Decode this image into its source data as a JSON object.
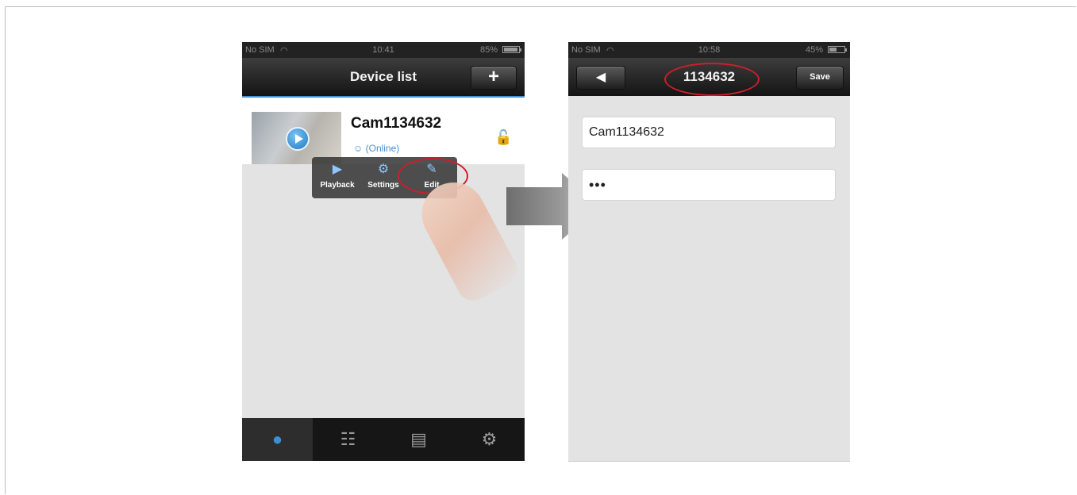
{
  "left_screen": {
    "status": {
      "carrier": "No SIM",
      "time": "10:41",
      "battery": "85%",
      "battery_level": 0.85
    },
    "nav": {
      "title": "Device list",
      "add_label": "+"
    },
    "device": {
      "name": "Cam1134632",
      "status": "(Online)"
    },
    "popup": {
      "items": [
        {
          "label": "Playback",
          "icon": "play-circle-icon"
        },
        {
          "label": "Settings",
          "icon": "gear-icon"
        },
        {
          "label": "Edit",
          "icon": "edit-icon"
        }
      ]
    },
    "tabbar": {
      "icons": [
        "user-icon",
        "grid-icon",
        "toolbox-icon",
        "gear-icon"
      ],
      "active_index": 0
    }
  },
  "right_screen": {
    "status": {
      "carrier": "No SIM",
      "time": "10:58",
      "battery": "45%",
      "battery_level": 0.45
    },
    "nav": {
      "title": "1134632",
      "save_label": "Save",
      "back_icon": "back-arrow-icon"
    },
    "fields": {
      "name_value": "Cam1134632",
      "password_value": "•••"
    }
  },
  "colors": {
    "accent": "#4a90d0",
    "highlight": "#cc1f2a",
    "navbar": "#1f1f1f",
    "background": "#e3e3e3"
  }
}
